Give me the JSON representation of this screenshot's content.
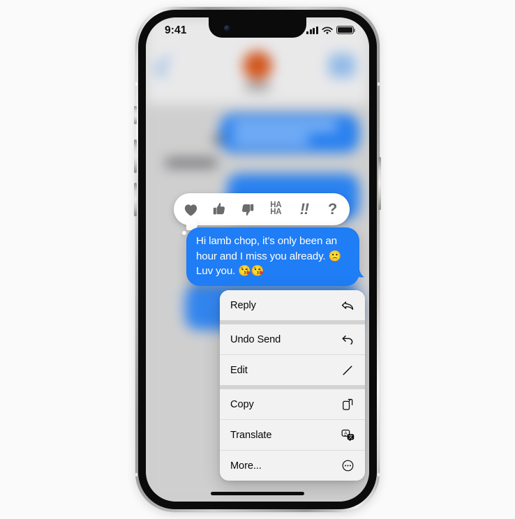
{
  "device": {
    "name": "iPhone",
    "status_bar": {
      "time": "9:41",
      "cellular_icon": "cellular-signal-icon",
      "wifi_icon": "wifi-icon",
      "battery_icon": "battery-full-icon"
    },
    "home_indicator": "home-indicator"
  },
  "app": {
    "name": "Messages"
  },
  "tapbacks": {
    "items": [
      {
        "id": "heart",
        "icon": "heart-icon",
        "label": "Heart"
      },
      {
        "id": "thumbsup",
        "icon": "thumbs-up-icon",
        "label": "Thumbs Up"
      },
      {
        "id": "thumbsdown",
        "icon": "thumbs-down-icon",
        "label": "Thumbs Down"
      },
      {
        "id": "haha",
        "icon": "haha-icon",
        "label": "HA HA",
        "line1": "HA",
        "line2": "HA"
      },
      {
        "id": "exclaim",
        "icon": "exclamation-icon",
        "label": "!!",
        "glyph": "‼"
      },
      {
        "id": "question",
        "icon": "question-icon",
        "label": "?",
        "glyph": "?"
      }
    ]
  },
  "message": {
    "sender": "me",
    "line1": "Hi lamb chop, it’s only been an",
    "line2_text": "hour and I miss you already. ",
    "line2_emoji": "🙁",
    "line3_text": "Luv you. ",
    "line3_emoji": "😘😘",
    "full_text": "Hi lamb chop, it’s only been an hour and I miss you already. 🙁 Luv you. 😘😘",
    "bubble_color": "#1f7df5",
    "text_color": "#ffffff"
  },
  "context_menu": {
    "groups": [
      {
        "items": [
          {
            "label": "Reply",
            "icon": "reply-arrow-icon"
          }
        ]
      },
      {
        "items": [
          {
            "label": "Undo Send",
            "icon": "undo-arrow-icon"
          },
          {
            "label": "Edit",
            "icon": "pencil-icon"
          }
        ]
      },
      {
        "items": [
          {
            "label": "Copy",
            "icon": "copy-documents-icon"
          },
          {
            "label": "Translate",
            "icon": "translate-icon"
          },
          {
            "label": "More...",
            "icon": "ellipsis-circle-icon"
          }
        ]
      }
    ]
  },
  "colors": {
    "page_background": "#fafafa",
    "screen_background": "#cfcfcf",
    "nav_background": "#e9e9ea",
    "bubble_blue": "#1f7df5",
    "menu_background": "#f2f2f2",
    "menu_separator": "#d3d3d3",
    "tapback_glyph": "#6b6b6b",
    "avatar_orange": "#d1561f"
  }
}
